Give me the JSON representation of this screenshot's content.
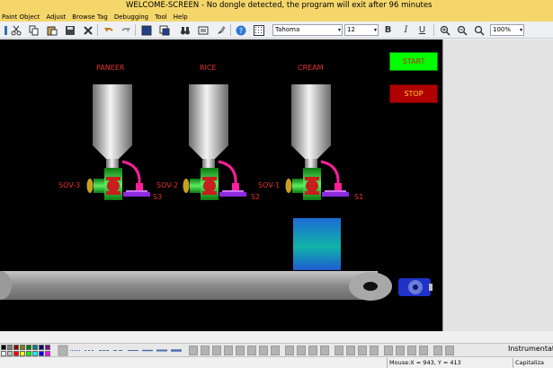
{
  "window": {
    "title": "WELCOME-SCREEN -      No dongle detected, the program will exit after 96 minutes"
  },
  "menu": {
    "items": [
      "Paint Object",
      "Adjust",
      "Browse Tag",
      "Debugging",
      "Tool",
      "Help"
    ]
  },
  "toolbar": {
    "font_name": "Tahoma",
    "font_size": "12",
    "zoom": "100%",
    "bold_label": "B",
    "italic_label": "I",
    "underline_label": "U"
  },
  "scene": {
    "hopper_labels": [
      "PANEER",
      "RICE",
      "CREAM"
    ],
    "valve_labels": [
      "SOV-3",
      "SOV-2",
      "SOV-1"
    ],
    "sensor_labels": [
      "S3",
      "S2",
      "S1"
    ],
    "start_label": "START",
    "stop_label": "STOP"
  },
  "colors": {
    "canvas": "#000000",
    "start_button": "#00ff00",
    "stop_button": "#b00000",
    "label_red": "#e8322b",
    "valve_green": "#22c32a",
    "valve_red": "#c81e1e",
    "hose_pink": "#ff1e9a",
    "container_blue": "#1e6bd6",
    "container_teal": "#10b3a8",
    "conveyor_gray": "#8a8a8a",
    "motor_blue": "#1f33c8",
    "title_bar": "#f5d66b"
  },
  "palette": {
    "label": "Instrumentation"
  },
  "status": {
    "mouse": "Mouse:X =  943, Y =  413",
    "caps": "Capitaliza"
  }
}
